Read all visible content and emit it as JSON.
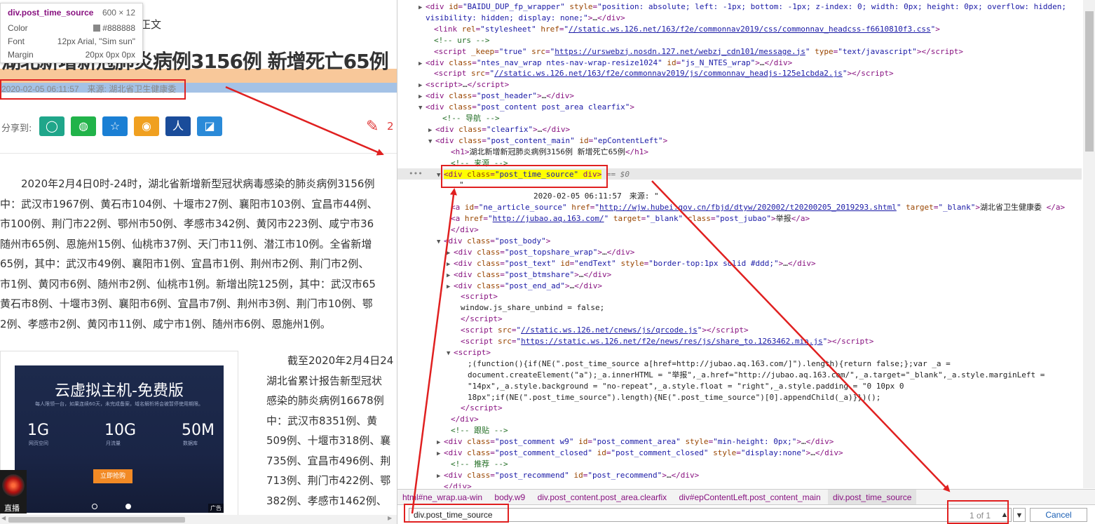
{
  "tooltip": {
    "element": "div.post_time_source",
    "size": "600 × 12",
    "color_label": "Color",
    "color_value": "#888888",
    "font_label": "Font",
    "font_value": "12px Arial, \"Sim sun\"",
    "margin_label": "Margin",
    "margin_value": "20px 0px 0px"
  },
  "article": {
    "nav_text": "正文",
    "headline": "湖北新增新冠肺炎病例3156例 新增死亡65例",
    "time_source": "2020-02-05 06:11:57　来源: 湖北省卫生健康委",
    "share_label": "分享到:",
    "share_icons": [
      "qzone-icon",
      "wechat-icon",
      "favorite-icon",
      "weibo-icon",
      "renren-icon",
      "yixin-icon"
    ],
    "comment_count": "2",
    "paragraph_lines": [
      "　　2020年2月4日0时-24时，湖北省新增新型冠状病毒感染的肺炎病例3156例",
      "中：武汉市1967例、黄石市104例、十堰市27例、襄阳市103例、宜昌市44例、",
      "市100例、荆门市22例、鄂州市50例、孝感市342例、黄冈市223例、咸宁市36",
      "随州市65例、恩施州15例、仙桃市37例、天门市11例、潜江市10例。全省新增",
      "65例，其中：武汉市49例、襄阳市1例、宜昌市1例、荆州市2例、荆门市2例、",
      "市1例、黄冈市6例、随州市2例、仙桃市1例。新增出院125例，其中：武汉市65",
      "黄石市8例、十堰市3例、襄阳市6例、宜昌市7例、荆州市3例、荆门市10例、鄂",
      "2例、孝感市2例、黄冈市11例、咸宁市1例、随州市6例、恩施州1例。"
    ],
    "paragraph2_lines": [
      "　　截至2020年2月4日24",
      "湖北省累计报告新型冠状",
      "感染的肺炎病例16678例",
      "中：武汉市8351例、黄",
      "509例、十堰市318例、襄",
      "735例、宜昌市496例、荆",
      "713例、荆门市422例、鄂",
      "382例、孝感市1462例、"
    ],
    "ad": {
      "title": "云虚拟主机-免费版",
      "subtitle": "每人限领一台，如果连续60天，未完成备案，域名解析将会被暂停使用期限。",
      "specs": [
        {
          "value": "1G",
          "label": "网页空间"
        },
        {
          "value": "10G",
          "label": "月流量"
        },
        {
          "value": "50M",
          "label": "数据库"
        }
      ],
      "button": "立即抢购",
      "tag": "广告"
    },
    "live_label": "直播"
  },
  "dom_lines": [
    {
      "indent": 40,
      "tri": "▶",
      "html": "<span class='tg'>&lt;div</span> <span class='at'>id</span>=<span class='av'>\"BAIDU_DUP_fp_wrapper\"</span> <span class='at'>style</span>=<span class='av'>\"position: absolute; left: -1px; bottom: -1px; z-index: 0; width: 0px; height: 0px; overflow: hidden;</span>"
    },
    {
      "indent": 40,
      "tri": "",
      "html": "<span class='av'>visibility: hidden; display: none;\"</span><span class='tg'>&gt;</span><span class='tx'>…</span><span class='tg'>&lt;/div&gt;</span>"
    },
    {
      "indent": 52,
      "tri": "",
      "html": "<span class='tg'>&lt;link</span> <span class='at'>rel</span>=<span class='av'>\"stylesheet\"</span> <span class='at'>href</span>=<span class='av'>\"<span class='lk'>//static.ws.126.net/163/f2e/commonnav2019/css/commonnav_headcss-f6610810f3.css</span>\"</span><span class='tg'>&gt;</span>"
    },
    {
      "indent": 52,
      "tri": "",
      "html": "<span class='cm'>&lt;!-- urs --&gt;</span>"
    },
    {
      "indent": 52,
      "tri": "",
      "html": "<span class='tg'>&lt;script</span> <span class='at'>_keep</span>=<span class='av'>\"true\"</span> <span class='at'>src</span>=<span class='av'>\"<span class='lk'>https://urswebzj.nosdn.127.net/webzj_cdn101/message.js</span>\"</span> <span class='at'>type</span>=<span class='av'>\"text/javascript\"</span><span class='tg'>&gt;&lt;/script&gt;</span>"
    },
    {
      "indent": 40,
      "tri": "▶",
      "html": "<span class='tg'>&lt;div</span> <span class='at'>class</span>=<span class='av'>\"ntes_nav_wrap ntes-nav-wrap-resize1024\"</span> <span class='at'>id</span>=<span class='av'>\"js_N_NTES_wrap\"</span><span class='tg'>&gt;</span><span class='tx'>…</span><span class='tg'>&lt;/div&gt;</span>"
    },
    {
      "indent": 52,
      "tri": "",
      "html": "<span class='tg'>&lt;script</span> <span class='at'>src</span>=<span class='av'>\"<span class='lk'>//static.ws.126.net/163/f2e/commonnav2019/js/commonnav_headjs-125e1cbda2.js</span>\"</span><span class='tg'>&gt;&lt;/script&gt;</span>"
    },
    {
      "indent": 40,
      "tri": "▶",
      "html": "<span class='tg'>&lt;script&gt;</span><span class='tx'>…</span><span class='tg'>&lt;/script&gt;</span>"
    },
    {
      "indent": 40,
      "tri": "▶",
      "html": "<span class='tg'>&lt;div</span> <span class='at'>class</span>=<span class='av'>\"post_header\"</span><span class='tg'>&gt;</span><span class='tx'>…</span><span class='tg'>&lt;/div&gt;</span>"
    },
    {
      "indent": 40,
      "tri": "▼",
      "html": "<span class='tg'>&lt;div</span> <span class='at'>class</span>=<span class='av'>\"post_content post_area clearfix\"</span><span class='tg'>&gt;</span>"
    },
    {
      "indent": 64,
      "tri": "",
      "html": "<span class='cm'>&lt;!-- 导航 --&gt;</span>"
    },
    {
      "indent": 54,
      "tri": "▶",
      "html": "<span class='tg'>&lt;div</span> <span class='at'>class</span>=<span class='av'>\"clearfix\"</span><span class='tg'>&gt;</span><span class='tx'>…</span><span class='tg'>&lt;/div&gt;</span>"
    },
    {
      "indent": 54,
      "tri": "▼",
      "html": "<span class='tg'>&lt;div</span> <span class='at'>class</span>=<span class='av'>\"post_content_main\"</span> <span class='at'>id</span>=<span class='av'>\"epContentLeft\"</span><span class='tg'>&gt;</span>"
    },
    {
      "indent": 76,
      "tri": "",
      "html": "<span class='tg'>&lt;h1&gt;</span><span class='tx'>湖北新增新冠肺炎病例3156例 新增死亡65例</span><span class='tg'>&lt;/h1&gt;</span>"
    },
    {
      "indent": 76,
      "tri": "",
      "html": "<span class='cm'>&lt;!-- 来源 --&gt;</span>"
    },
    {
      "indent": 66,
      "tri": "▼",
      "html": "<span class='sel-hl'>&lt;div <span class='at'>class</span>=<span class='av'>\"post_time_source\"</span> div&gt;</span> <span class='dollar'>== $0</span>"
    },
    {
      "indent": 88,
      "tri": "",
      "html": "<span class='tx'>\"</span>"
    },
    {
      "indent": 88,
      "tri": "",
      "html": "<span class='tx'>                2020-02-05 06:11:57　来源: \"</span>"
    },
    {
      "indent": 76,
      "tri": "",
      "html": "<span class='tg'>&lt;a</span> <span class='at'>id</span>=<span class='av'>\"ne_article_source\"</span> <span class='at'>href</span>=<span class='av'>\"<span class='lk'>http://wjw.hubei.gov.cn/fbjd/dtyw/202002/t20200205_2019293.shtml</span>\"</span> <span class='at'>target</span>=<span class='av'>\"_blank\"</span><span class='tg'>&gt;</span><span class='tx'>湖北省卫生健康委 </span><span class='tg'>&lt;/a&gt;</span>"
    },
    {
      "indent": 76,
      "tri": "",
      "html": "<span class='tg'>&lt;a</span> <span class='at'>href</span>=<span class='av'>\"<span class='lk'>http://jubao.aq.163.com/</span>\"</span> <span class='at'>target</span>=<span class='av'>\"_blank\"</span> <span class='at'>class</span>=<span class='av'>\"post_jubao\"</span><span class='tg'>&gt;</span><span class='tx'>举报</span><span class='tg'>&lt;/a&gt;</span>"
    },
    {
      "indent": 76,
      "tri": "",
      "html": "<span class='tg'>&lt;/div&gt;</span>"
    },
    {
      "indent": 66,
      "tri": "▼",
      "html": "<span class='tg'>&lt;div</span> <span class='at'>class</span>=<span class='av'>\"post_body\"</span><span class='tg'>&gt;</span>"
    },
    {
      "indent": 80,
      "tri": "▶",
      "html": "<span class='tg'>&lt;div</span> <span class='at'>class</span>=<span class='av'>\"post_topshare_wrap\"</span><span class='tg'>&gt;</span><span class='tx'>…</span><span class='tg'>&lt;/div&gt;</span>"
    },
    {
      "indent": 80,
      "tri": "▶",
      "html": "<span class='tg'>&lt;div</span> <span class='at'>class</span>=<span class='av'>\"post_text\"</span> <span class='at'>id</span>=<span class='av'>\"endText\"</span> <span class='at'>style</span>=<span class='av'>\"border-top:1px solid #ddd;\"</span><span class='tg'>&gt;</span><span class='tx'>…</span><span class='tg'>&lt;/div&gt;</span>"
    },
    {
      "indent": 80,
      "tri": "▶",
      "html": "<span class='tg'>&lt;div</span> <span class='at'>class</span>=<span class='av'>\"post_btmshare\"</span><span class='tg'>&gt;</span><span class='tx'>…</span><span class='tg'>&lt;/div&gt;</span>"
    },
    {
      "indent": 80,
      "tri": "▶",
      "html": "<span class='tg'>&lt;div</span> <span class='at'>class</span>=<span class='av'>\"post_end_ad\"</span><span class='tg'>&gt;</span><span class='tx'>…</span><span class='tg'>&lt;/div&gt;</span>"
    },
    {
      "indent": 90,
      "tri": "",
      "html": "<span class='tg'>&lt;script&gt;</span>"
    },
    {
      "indent": 90,
      "tri": "",
      "html": "<span class='tx'>window.js_share_unbind = false;</span>"
    },
    {
      "indent": 90,
      "tri": "",
      "html": "<span class='tg'>&lt;/script&gt;</span>"
    },
    {
      "indent": 90,
      "tri": "",
      "html": "<span class='tg'>&lt;script</span> <span class='at'>src</span>=<span class='av'>\"<span class='lk'>//static.ws.126.net/cnews/js/qrcode.js</span>\"</span><span class='tg'>&gt;&lt;/script&gt;</span>"
    },
    {
      "indent": 90,
      "tri": "",
      "html": "<span class='tg'>&lt;script</span> <span class='at'>src</span>=<span class='av'>\"<span class='lk'>https://static.ws.126.net/f2e/news/res/js/share_to.1263462.min.js</span>\"</span><span class='tg'>&gt;&lt;/script&gt;</span>"
    },
    {
      "indent": 80,
      "tri": "▼",
      "html": "<span class='tg'>&lt;script&gt;</span>"
    },
    {
      "indent": 100,
      "tri": "",
      "html": "<span class='tx'>;(function(){if(NE(\".post_time_source a[href=http://jubao.aq.163.com/]\").length){return false;};var _a =</span>"
    },
    {
      "indent": 100,
      "tri": "",
      "html": "<span class='tx'>document.createElement(\"a\");_a.innerHTML = \"举报\",_a.href=\"http://jubao.aq.163.com/\",_a.target=\"_blank\",_a.style.marginLeft =</span>"
    },
    {
      "indent": 100,
      "tri": "",
      "html": "<span class='tx'>\"14px\",_a.style.background = \"no-repeat\",_a.style.float = \"right\",_a.style.padding = \"0 10px 0</span>"
    },
    {
      "indent": 100,
      "tri": "",
      "html": "<span class='tx'>18px\";if(NE(\".post_time_source\").length){NE(\".post_time_source\")[0].appendChild(_a)}})();</span>"
    },
    {
      "indent": 90,
      "tri": "",
      "html": "<span class='tg'>&lt;/script&gt;</span>"
    },
    {
      "indent": 76,
      "tri": "",
      "html": "<span class='tg'>&lt;/div&gt;</span>"
    },
    {
      "indent": 76,
      "tri": "",
      "html": "<span class='cm'>&lt;!-- 跟贴 --&gt;</span>"
    },
    {
      "indent": 66,
      "tri": "▶",
      "html": "<span class='tg'>&lt;div</span> <span class='at'>class</span>=<span class='av'>\"post_comment w9\"</span> <span class='at'>id</span>=<span class='av'>\"post_comment_area\"</span> <span class='at'>style</span>=<span class='av'>\"min-height: 0px;\"</span><span class='tg'>&gt;</span><span class='tx'>…</span><span class='tg'>&lt;/div&gt;</span>"
    },
    {
      "indent": 66,
      "tri": "▶",
      "html": "<span class='tg'>&lt;div</span> <span class='at'>class</span>=<span class='av'>\"post_comment_closed\"</span> <span class='at'>id</span>=<span class='av'>\"post_comment_closed\"</span> <span class='at'>style</span>=<span class='av'>\"display:none\"</span><span class='tg'>&gt;</span><span class='tx'>…</span><span class='tg'>&lt;/div&gt;</span>"
    },
    {
      "indent": 76,
      "tri": "",
      "html": "<span class='cm'>&lt;!-- 推荐 --&gt;</span>"
    },
    {
      "indent": 66,
      "tri": "▶",
      "html": "<span class='tg'>&lt;div</span> <span class='at'>class</span>=<span class='av'>\"post_recommend\"</span> <span class='at'>id</span>=<span class='av'>\"post_recommend\"</span><span class='tg'>&gt;</span><span class='tx'>…</span><span class='tg'>&lt;/div&gt;</span>"
    },
    {
      "indent": 66,
      "tri": "",
      "html": "<span class='tg'>&lt;/div&gt;</span>"
    }
  ],
  "breadcrumbs": [
    "html#ne_wrap.ua-win",
    "body.w9",
    "div.post_content.post_area.clearfix",
    "div#epContentLeft.post_content_main",
    "div.post_time_source"
  ],
  "find": {
    "query": "div.post_time_source",
    "count": "1 of 1",
    "up": "▲",
    "down": "▼",
    "cancel": "Cancel"
  },
  "colors": {
    "annotation_red": "#e02020",
    "selection_yellow": "#ffff00",
    "tag_purple": "#881280"
  }
}
